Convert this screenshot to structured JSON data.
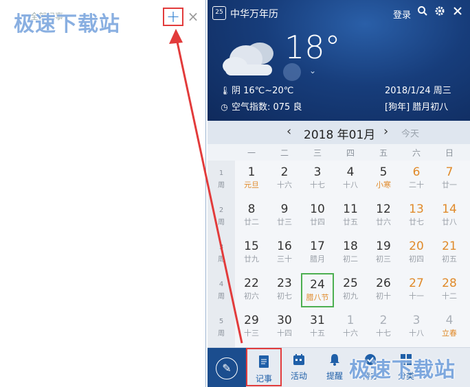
{
  "left_panel": {
    "note_title": "全部记事",
    "add_label": "+",
    "close_label": "×",
    "watermark": "极速下载站"
  },
  "app": {
    "title": "中华万年历",
    "logo": "25",
    "login": "登录",
    "icons": {
      "search": "search-icon",
      "settings": "gear-icon",
      "close": "close-icon"
    }
  },
  "weather": {
    "temperature": "18°",
    "condition": "阴 16℃~20℃",
    "date_label": "2018/1/24 周三",
    "aqi": "空气指数: 075 良",
    "lunar": "[狗年] 腊月初八"
  },
  "calendar": {
    "month_label": "2018 年01月",
    "today_label": "今天",
    "weekdays": [
      "一",
      "二",
      "三",
      "四",
      "五",
      "六",
      "日"
    ],
    "week_numbers": [
      {
        "n": "1",
        "w": "周"
      },
      {
        "n": "2",
        "w": "周"
      },
      {
        "n": "3",
        "w": "周"
      },
      {
        "n": "4",
        "w": "周"
      },
      {
        "n": "5",
        "w": "周"
      }
    ],
    "weeks": [
      [
        {
          "d": "1",
          "l": "元旦",
          "hl": true
        },
        {
          "d": "2",
          "l": "十六"
        },
        {
          "d": "3",
          "l": "十七"
        },
        {
          "d": "4",
          "l": "十八"
        },
        {
          "d": "5",
          "l": "小寒",
          "hl": true
        },
        {
          "d": "6",
          "l": "二十"
        },
        {
          "d": "7",
          "l": "廿一"
        }
      ],
      [
        {
          "d": "8",
          "l": "廿二"
        },
        {
          "d": "9",
          "l": "廿三"
        },
        {
          "d": "10",
          "l": "廿四"
        },
        {
          "d": "11",
          "l": "廿五"
        },
        {
          "d": "12",
          "l": "廿六"
        },
        {
          "d": "13",
          "l": "廿七"
        },
        {
          "d": "14",
          "l": "廿八"
        }
      ],
      [
        {
          "d": "15",
          "l": "廿九"
        },
        {
          "d": "16",
          "l": "三十"
        },
        {
          "d": "17",
          "l": "腊月"
        },
        {
          "d": "18",
          "l": "初二"
        },
        {
          "d": "19",
          "l": "初三"
        },
        {
          "d": "20",
          "l": "初四"
        },
        {
          "d": "21",
          "l": "初五"
        }
      ],
      [
        {
          "d": "22",
          "l": "初六"
        },
        {
          "d": "23",
          "l": "初七"
        },
        {
          "d": "24",
          "l": "腊八节",
          "today": true
        },
        {
          "d": "25",
          "l": "初九"
        },
        {
          "d": "26",
          "l": "初十"
        },
        {
          "d": "27",
          "l": "十一"
        },
        {
          "d": "28",
          "l": "十二"
        }
      ],
      [
        {
          "d": "29",
          "l": "十三"
        },
        {
          "d": "30",
          "l": "十四"
        },
        {
          "d": "31",
          "l": "十五"
        },
        {
          "d": "1",
          "l": "十六",
          "other": true
        },
        {
          "d": "2",
          "l": "十七",
          "other": true
        },
        {
          "d": "3",
          "l": "十八",
          "other": true
        },
        {
          "d": "4",
          "l": "立春",
          "hl": true,
          "other": true
        }
      ]
    ]
  },
  "bottom_tabs": {
    "notes": "记事",
    "activities": "活动",
    "reminders": "提醒",
    "todo": "待办",
    "categories": "分类"
  },
  "colors": {
    "accent": "#1f5fa8",
    "header_bg": "#173d7b",
    "highlight_red": "#e23b3b",
    "today_green": "#4caf50",
    "weekend_orange": "#e08a2a"
  },
  "bottom_watermark": "极速下载站"
}
